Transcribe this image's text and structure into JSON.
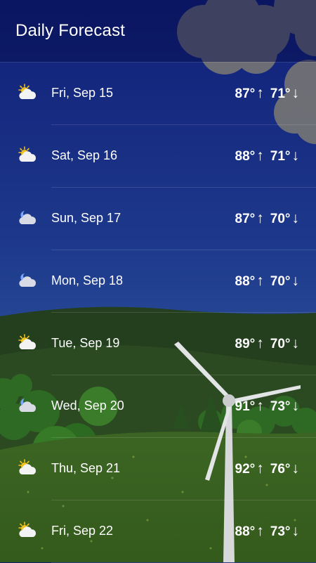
{
  "header": {
    "title": "Daily Forecast"
  },
  "forecast": [
    {
      "date": "Fri, Sep 15",
      "icon": "partly-sunny-icon",
      "high": "87°",
      "low": "71°"
    },
    {
      "date": "Sat, Sep 16",
      "icon": "partly-sunny-icon",
      "high": "88°",
      "low": "71°"
    },
    {
      "date": "Sun, Sep 17",
      "icon": "partly-cloudy-night-icon",
      "high": "87°",
      "low": "70°"
    },
    {
      "date": "Mon, Sep 18",
      "icon": "partly-cloudy-night-icon",
      "high": "88°",
      "low": "70°"
    },
    {
      "date": "Tue, Sep 19",
      "icon": "partly-sunny-icon",
      "high": "89°",
      "low": "70°"
    },
    {
      "date": "Wed, Sep 20",
      "icon": "partly-cloudy-night-icon",
      "high": "91°",
      "low": "73°"
    },
    {
      "date": "Thu, Sep 21",
      "icon": "partly-sunny-icon",
      "high": "92°",
      "low": "76°"
    },
    {
      "date": "Fri, Sep 22",
      "icon": "partly-sunny-icon",
      "high": "88°",
      "low": "73°"
    }
  ],
  "arrows": {
    "up": "↑",
    "down": "↓"
  },
  "colors": {
    "sky_top": "#1a2a86",
    "sky_bottom": "#3a63a8",
    "hill": "#27461f",
    "grass": "#3f6a22",
    "sun": "#f2c21b"
  }
}
